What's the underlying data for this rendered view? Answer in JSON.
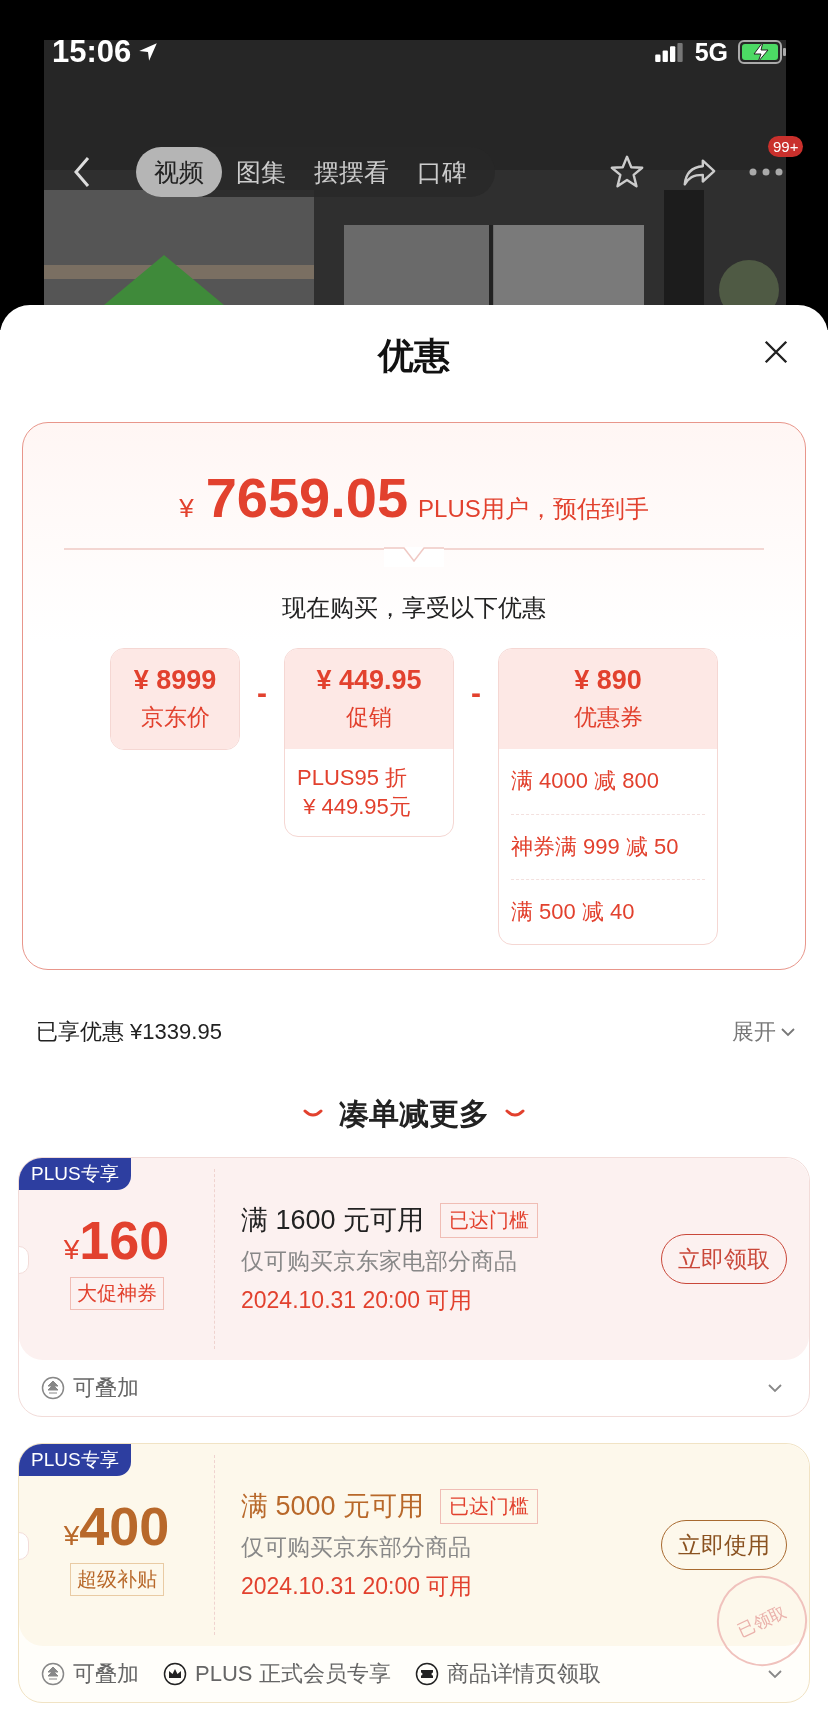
{
  "status_bar": {
    "time": "15:06",
    "network": "5G"
  },
  "nav": {
    "tabs": [
      {
        "label": "视频",
        "selected": true
      },
      {
        "label": "图集",
        "selected": false
      },
      {
        "label": "摆摆看",
        "selected": false
      },
      {
        "label": "口碑",
        "selected": false
      }
    ],
    "badge": "99+"
  },
  "sheet": {
    "title": "优惠"
  },
  "summary": {
    "currency": "¥",
    "price": "7659.05",
    "note": "PLUS用户，预估到手",
    "subtitle": "现在购买，享受以下优惠",
    "parts": [
      {
        "amount": "¥ 8999",
        "label": "京东价"
      },
      {
        "operator": "-",
        "amount": "¥ 449.95",
        "label": "促销",
        "details": [
          "PLUS95 折\n ¥ 449.95元"
        ]
      },
      {
        "operator": "-",
        "amount": "¥ 890",
        "label": "优惠券",
        "details": [
          "满 4000 减 800",
          "神券满 999 减 50",
          "满 500 减 40"
        ]
      }
    ]
  },
  "savings": {
    "label": "已享优惠 ¥1339.95",
    "toggle": "展开"
  },
  "section_title": "凑单减更多",
  "coupons": [
    {
      "kind": "red",
      "tag": "PLUS专享",
      "currency": "¥",
      "amount": "160",
      "type": "大促神券",
      "condition": "满 1600 元可用",
      "status": "已达门槛",
      "scope": "仅可购买京东家电部分商品",
      "time": "2024.10.31 20:00 可用",
      "button": "立即领取",
      "features": [
        {
          "kind": "stack",
          "label": "可叠加"
        }
      ]
    },
    {
      "kind": "gold",
      "tag": "PLUS专享",
      "currency": "¥",
      "amount": "400",
      "type": "超级补贴",
      "condition": "满 5000 元可用",
      "status": "已达门槛",
      "scope": "仅可购买京东部分商品",
      "time": "2024.10.31 20:00 可用",
      "button": "立即使用",
      "stamp": "已领取",
      "features": [
        {
          "kind": "stack",
          "label": "可叠加"
        },
        {
          "kind": "crown",
          "label": "PLUS 正式会员专享"
        },
        {
          "kind": "ticket",
          "label": "商品详情页领取"
        }
      ]
    }
  ]
}
